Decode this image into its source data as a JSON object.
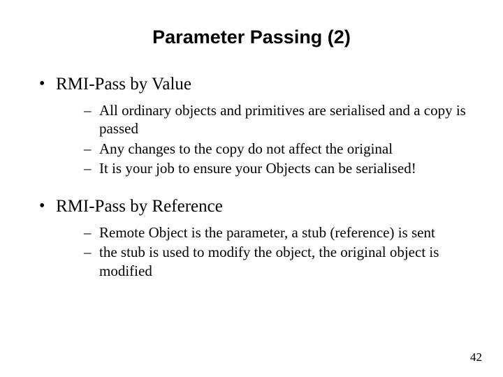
{
  "title": "Parameter Passing (2)",
  "bullets": [
    {
      "text": "RMI-Pass by Value",
      "subs": [
        "All ordinary objects and primitives are serialised and a copy is passed",
        "Any changes to the copy do not affect the original",
        "It is your job to ensure your Objects can be serialised!"
      ]
    },
    {
      "text": "RMI-Pass by Reference",
      "subs": [
        "Remote Object is the parameter, a stub (reference) is sent",
        "the stub is used to modify the object, the original object is modified"
      ]
    }
  ],
  "page_number": "42"
}
